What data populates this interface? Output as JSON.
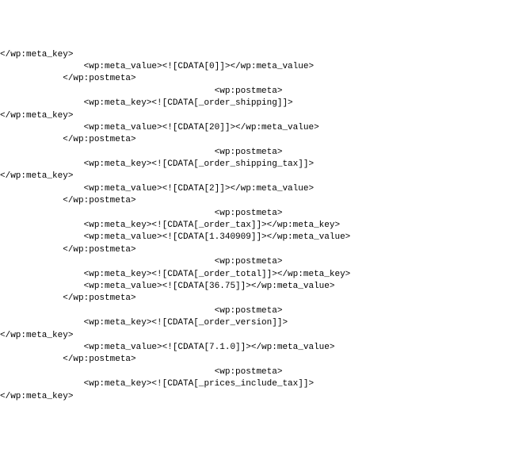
{
  "lines": [
    "</wp:meta_key>",
    "                <wp:meta_value><![CDATA[0]]></wp:meta_value>",
    "            </wp:postmeta>",
    "                                         <wp:postmeta>",
    "                <wp:meta_key><![CDATA[_order_shipping]]>",
    "</wp:meta_key>",
    "                <wp:meta_value><![CDATA[20]]></wp:meta_value>",
    "            </wp:postmeta>",
    "                                         <wp:postmeta>",
    "                <wp:meta_key><![CDATA[_order_shipping_tax]]>",
    "</wp:meta_key>",
    "                <wp:meta_value><![CDATA[2]]></wp:meta_value>",
    "            </wp:postmeta>",
    "                                         <wp:postmeta>",
    "                <wp:meta_key><![CDATA[_order_tax]]></wp:meta_key>",
    "                <wp:meta_value><![CDATA[1.340909]]></wp:meta_value>",
    "            </wp:postmeta>",
    "                                         <wp:postmeta>",
    "                <wp:meta_key><![CDATA[_order_total]]></wp:meta_key>",
    "                <wp:meta_value><![CDATA[36.75]]></wp:meta_value>",
    "            </wp:postmeta>",
    "                                         <wp:postmeta>",
    "                <wp:meta_key><![CDATA[_order_version]]>",
    "</wp:meta_key>",
    "                <wp:meta_value><![CDATA[7.1.0]]></wp:meta_value>",
    "            </wp:postmeta>",
    "                                         <wp:postmeta>",
    "                <wp:meta_key><![CDATA[_prices_include_tax]]>",
    "</wp:meta_key>"
  ]
}
